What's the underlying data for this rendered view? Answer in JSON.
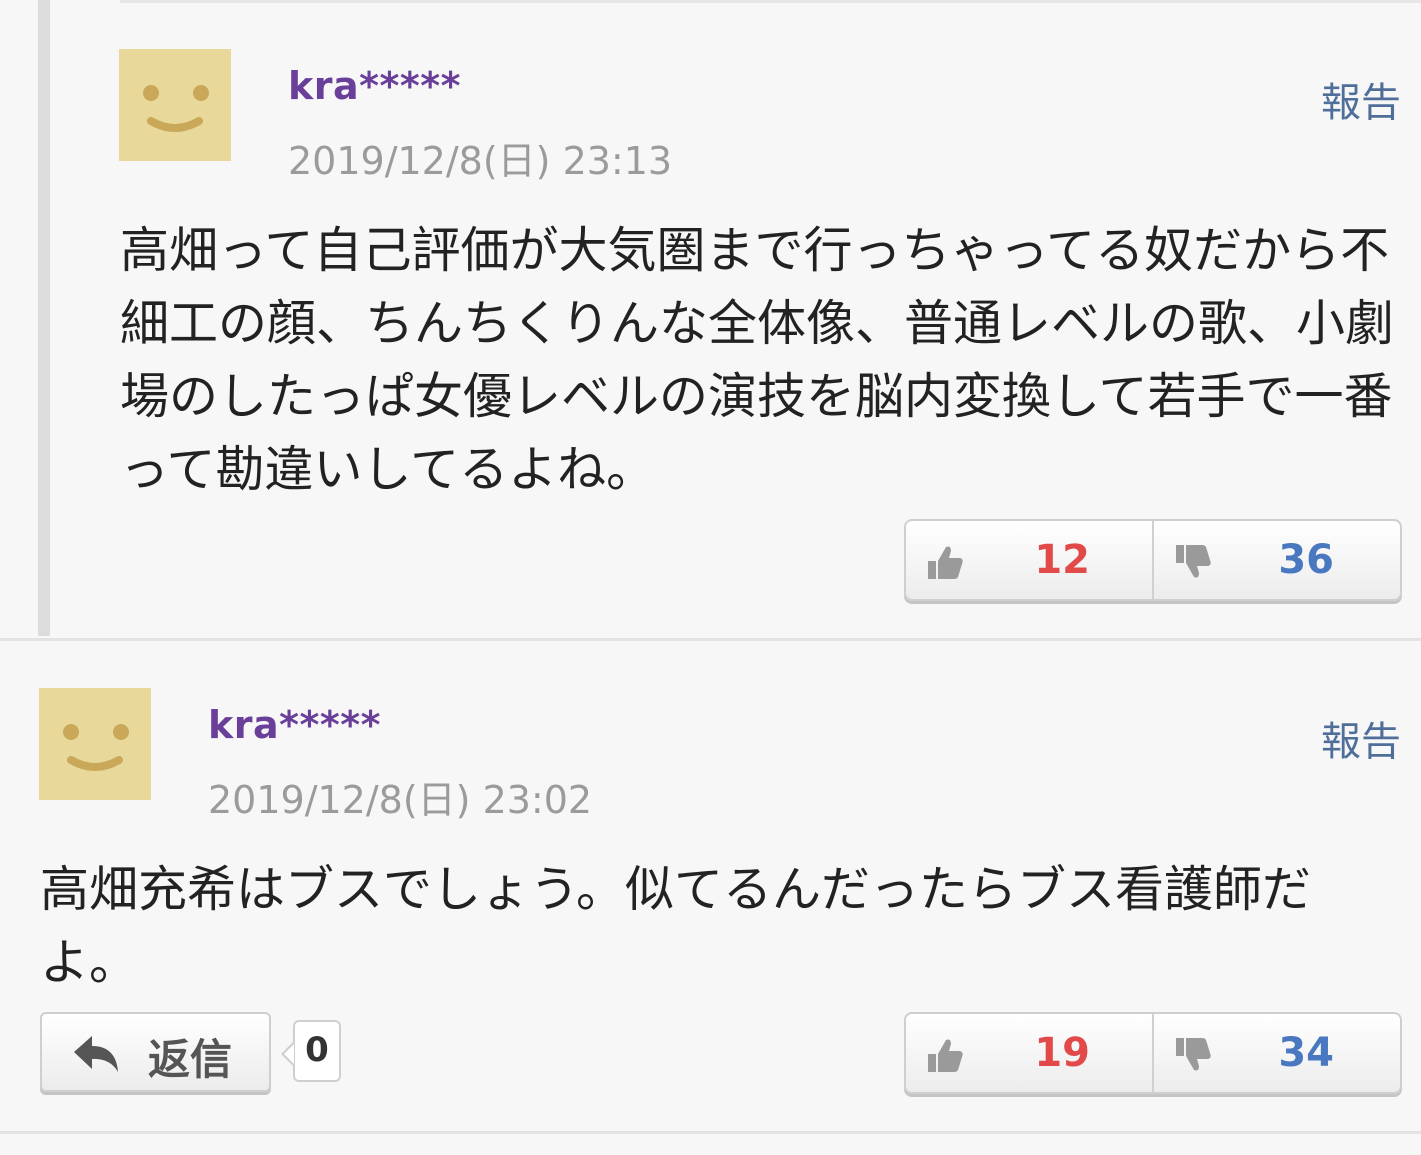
{
  "comments": [
    {
      "username": "kra*****",
      "timestamp": "2019/12/8(日) 23:13",
      "report_label": "報告",
      "body": "高畑って自己評価が大気圏まで行っちゃってる奴だから不細工の顔、ちんちくりんな全体像、普通レベルの歌、小劇場のしたっぱ女優レベルの演技を脳内変換して若手で一番って勘違いしてるよね。",
      "likes": "12",
      "dislikes": "36",
      "avatar_icon": "smiley-face-icon"
    },
    {
      "username": "kra*****",
      "timestamp": "2019/12/8(日) 23:02",
      "report_label": "報告",
      "body": "高畑充希はブスでしょう。似てるんだったらブス看護師だよ。",
      "likes": "19",
      "dislikes": "34",
      "reply_label": "返信",
      "reply_count": "0",
      "avatar_icon": "smiley-face-icon"
    }
  ],
  "colors": {
    "username": "#6a3f9a",
    "like_count": "#e24a4a",
    "dislike_count": "#4a78c0",
    "report_link": "#4f6f9a",
    "avatar_bg": "#e8d99a"
  }
}
